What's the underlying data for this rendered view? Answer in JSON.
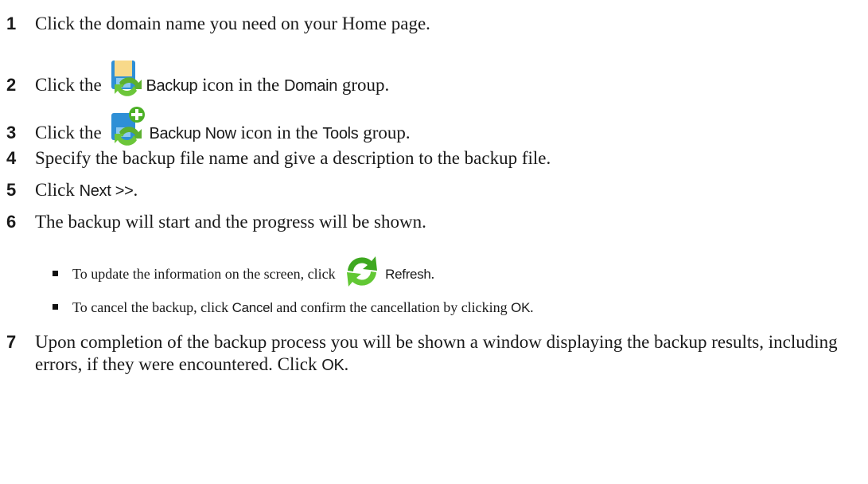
{
  "steps": [
    {
      "num": "1",
      "text": "Click the domain name you need on your Home page."
    },
    {
      "num": "2",
      "pre": "Click the",
      "icon": "backup-floppy-icon",
      "ui1": "Backup",
      "mid": "icon in the",
      "ui2": "Domain",
      "post": "group."
    },
    {
      "num": "3",
      "pre": "Click the",
      "icon": "backup-now-icon",
      "ui1": "Backup Now",
      "mid": "icon in the",
      "ui2": "Tools",
      "post": "group."
    },
    {
      "num": "4",
      "text": "Specify the backup file name and give a description to the backup file."
    },
    {
      "num": "5",
      "pre": "Click",
      "ui1": "Next >>",
      "post": "."
    },
    {
      "num": "6",
      "text": "The backup will start and the progress will be shown."
    },
    {
      "num": "7",
      "text": "Upon completion of the backup process you will be shown a window displaying the backup results, including errors, if they were encountered.",
      "pre2": "Click",
      "ui1": "OK",
      "post": "."
    }
  ],
  "bullets": [
    {
      "pre": "To update the information on the screen, click",
      "icon": "refresh-icon",
      "ui1": "Refresh",
      "post": "."
    },
    {
      "pre": "To cancel the backup, click",
      "ui1": "Cancel",
      "mid": "and confirm the cancellation by clicking",
      "ui2": "OK",
      "post": "."
    }
  ]
}
